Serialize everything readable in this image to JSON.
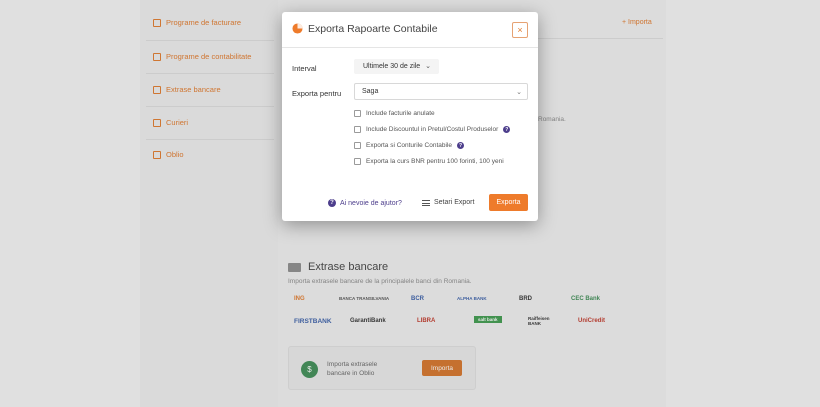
{
  "sidebar": {
    "items": [
      {
        "label": "Programe de facturare",
        "icon": "invoice-icon"
      },
      {
        "label": "Programe de contabilitate",
        "icon": "document-icon"
      },
      {
        "label": "Extrase bancare",
        "icon": "card-icon"
      },
      {
        "label": "Curieri",
        "icon": "courier-icon"
      },
      {
        "label": "Oblio",
        "icon": "leaf-icon"
      }
    ]
  },
  "background": {
    "import_link": "+ Importa",
    "partial_text": "Romania.",
    "bank_section": {
      "title": "Extrase bancare",
      "subtitle": "Importa extrasele bancare de la principalele banci din Romania.",
      "logos": [
        "ING",
        "BANCA TRANSILVANIA",
        "BCR",
        "ALPHA BANK",
        "BRD",
        "CEC Bank",
        "FIRSTBANK",
        "GarantiBank",
        "LIBRA",
        "salt bank",
        "Raiffeisen BANK",
        "UniCredit"
      ],
      "import_card_text": "Importa extrasele bancare in Oblio",
      "import_button": "Importa"
    }
  },
  "modal": {
    "title": "Exporta Rapoarte Contabile",
    "close_label": "×",
    "interval_label": "Interval",
    "interval_value": "Ultimele 30 de zile",
    "export_for_label": "Exporta pentru",
    "export_for_value": "Saga",
    "options": [
      {
        "label": "Include facturile anulate",
        "help": false
      },
      {
        "label": "Include Discountul in Pretul/Costul Produselor",
        "help": true
      },
      {
        "label": "Exporta si Conturile Contabile",
        "help": true
      },
      {
        "label": "Exporta la curs BNR pentru 100 forinti, 100 yeni",
        "help": false
      }
    ],
    "help_link": "Ai nevoie de ajutor?",
    "settings_link": "Setari Export",
    "export_button": "Exporta"
  },
  "colors": {
    "accent": "#ee7b2b",
    "help": "#4d3e8c"
  }
}
